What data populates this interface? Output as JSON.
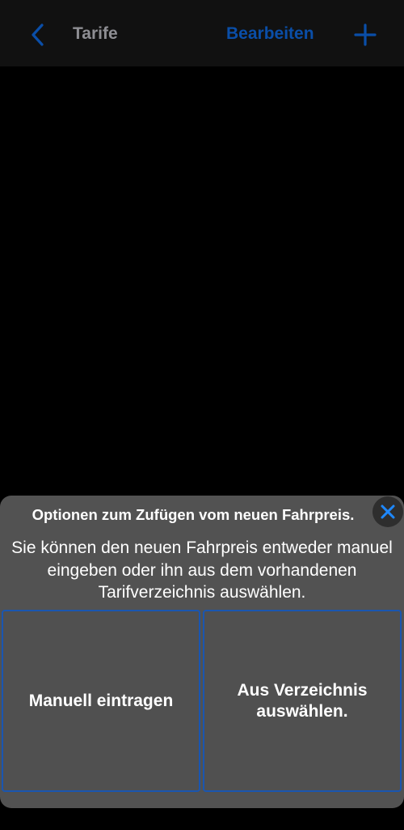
{
  "nav": {
    "title": "Tarife",
    "edit_label": "Bearbeiten",
    "accent_color": "#0a4ea8"
  },
  "sheet": {
    "title": "Optionen zum Zufügen vom neuen Fahrpreis.",
    "message": "Sie können den neuen Fahrpreis entweder manuel eingeben oder ihn aus dem vorhandenen Tarifverzeichnis auswählen.",
    "close_icon": "close-icon",
    "close_color": "#1e88ff",
    "options": [
      {
        "label": "Manuell eintragen"
      },
      {
        "label": "Aus Verzeichnis auswählen."
      }
    ]
  }
}
